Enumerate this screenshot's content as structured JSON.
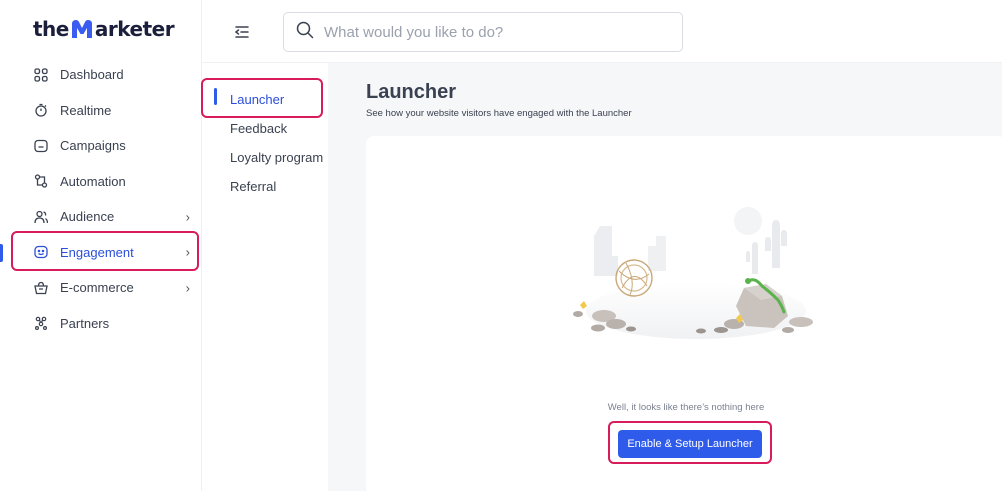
{
  "logo": {
    "text_pre": "the",
    "text_post": "arketer",
    "accent": "#3a5cf0"
  },
  "nav": {
    "items": [
      {
        "label": "Dashboard",
        "icon": "grid-icon"
      },
      {
        "label": "Realtime",
        "icon": "stopwatch-icon"
      },
      {
        "label": "Campaigns",
        "icon": "folder-icon"
      },
      {
        "label": "Automation",
        "icon": "flow-icon"
      },
      {
        "label": "Audience",
        "icon": "users-icon",
        "chevron": "›"
      },
      {
        "label": "Engagement",
        "icon": "chat-icon",
        "chevron": "›"
      },
      {
        "label": "E-commerce",
        "icon": "basket-icon",
        "chevron": "›"
      },
      {
        "label": "Partners",
        "icon": "partners-icon"
      }
    ]
  },
  "search": {
    "placeholder": "What would you like to do?"
  },
  "subnav": {
    "items": [
      "Launcher",
      "Feedback",
      "Loyalty program",
      "Referral"
    ]
  },
  "page": {
    "title": "Launcher",
    "subtitle": "See how your website visitors have engaged with the Launcher",
    "empty_message": "Well, it looks like there’s nothing here",
    "cta_label": "Enable & Setup Launcher"
  },
  "colors": {
    "primary": "#2f5bea",
    "highlight": "#d81b5a",
    "text": "#3a4150"
  }
}
